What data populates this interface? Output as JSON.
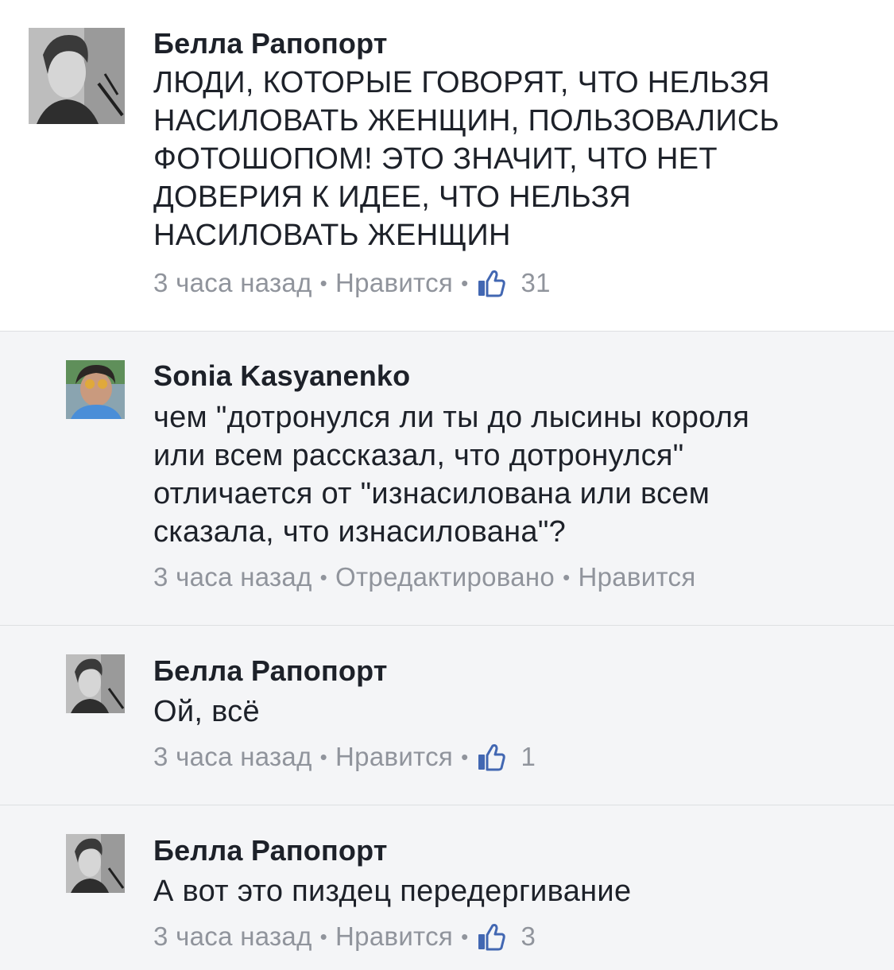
{
  "comments": [
    {
      "author": "Белла Рапопорт",
      "lines": [
        "ЛЮДИ, КОТОРЫЕ ГОВОРЯТ, ЧТО НЕЛЬЗЯ",
        "НАСИЛОВАТЬ ЖЕНЩИН, ПОЛЬЗОВАЛИСЬ",
        "ФОТОШОПОМ! ЭТО ЗНАЧИТ, ЧТО НЕТ",
        "ДОВЕРИЯ К ИДЕЕ, ЧТО НЕЛЬЗЯ",
        "НАСИЛОВАТЬ ЖЕНЩИН"
      ],
      "time": "3 часа назад",
      "like_label": "Нравится",
      "like_count": "31"
    },
    {
      "author": "Sonia Kasyanenko",
      "lines": [
        "чем \"дотронулся ли ты до лысины короля",
        "или всем рассказал, что дотронулся\"",
        "отличается от \"изнасилована или всем",
        "сказала, что изнасилована\"?"
      ],
      "time": "3 часа назад",
      "edited_label": "Отредактировано",
      "like_label": "Нравится"
    },
    {
      "author": "Белла Рапопорт",
      "lines": [
        "Ой, всё"
      ],
      "time": "3 часа назад",
      "like_label": "Нравится",
      "like_count": "1"
    },
    {
      "author": "Белла Рапопорт",
      "lines": [
        "А вот это пиздец передергивание"
      ],
      "time": "3 часа назад",
      "like_label": "Нравится",
      "like_count": "3"
    }
  ],
  "icons": {
    "like": "thumbs-up-icon"
  },
  "colors": {
    "meta_text": "#90949c",
    "like_icon": "#4267b2",
    "reply_background": "#f4f5f7"
  }
}
